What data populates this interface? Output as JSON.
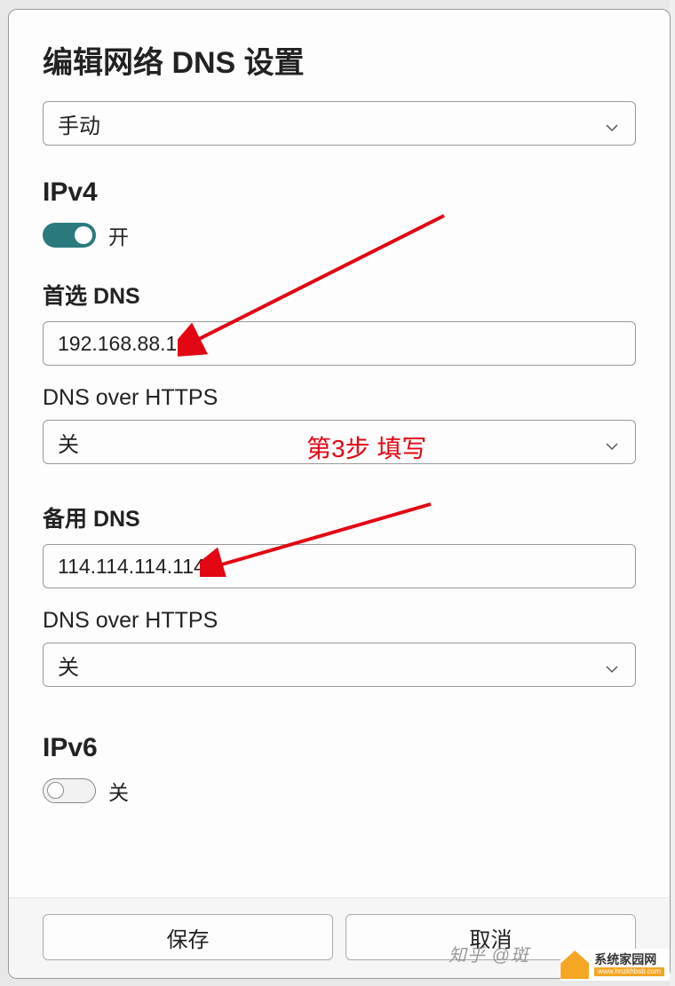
{
  "dialog": {
    "title": "编辑网络 DNS 设置",
    "mode_select": "手动"
  },
  "ipv4": {
    "heading": "IPv4",
    "toggle_state": "开",
    "primary_dns_label": "首选 DNS",
    "primary_dns_value": "192.168.88.1",
    "doh1_label": "DNS over HTTPS",
    "doh1_value": "关",
    "alt_dns_label": "备用 DNS",
    "alt_dns_value": "114.114.114.114",
    "doh2_label": "DNS over HTTPS",
    "doh2_value": "关"
  },
  "ipv6": {
    "heading": "IPv6",
    "toggle_state": "关"
  },
  "buttons": {
    "save": "保存",
    "cancel": "取消"
  },
  "annotation": {
    "step_text": "第3步 填写"
  },
  "watermark": {
    "zhihu": "知乎 @斑",
    "site_cn": "系统家园网",
    "site_url": "www.hnzkhbsb.com"
  }
}
